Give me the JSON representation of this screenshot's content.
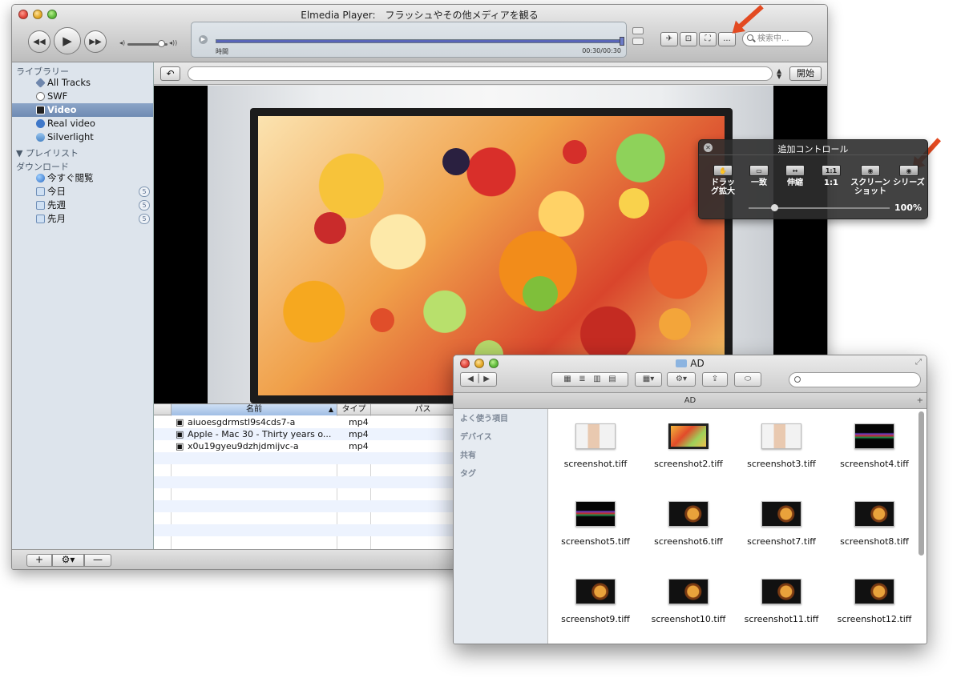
{
  "player": {
    "title": "Elmedia Player:　フラッシュやその他メディアを観る",
    "time_label": "時間",
    "time_value": "00:30/00:30",
    "progress": 1.0,
    "more_label": "...",
    "search_placeholder": "検索中...",
    "sidebar": {
      "library_header": "ライブラリー",
      "items": [
        {
          "label": "All Tracks",
          "icon": "music-note-icon"
        },
        {
          "label": "SWF",
          "icon": "flash-icon"
        },
        {
          "label": "Video",
          "icon": "film-icon",
          "selected": true
        },
        {
          "label": "Real video",
          "icon": "real-icon"
        },
        {
          "label": "Silverlight",
          "icon": "silverlight-icon"
        }
      ],
      "playlist_header": "▼ プレイリスト",
      "download_header": "ダウンロード",
      "download_items": [
        {
          "label": "今すぐ閲覧",
          "badge": ""
        },
        {
          "label": "今日",
          "badge": "5"
        },
        {
          "label": "先週",
          "badge": "5"
        },
        {
          "label": "先月",
          "badge": "5"
        }
      ]
    },
    "go_button": "開始",
    "table": {
      "columns": [
        "名前",
        "タイプ",
        "パス"
      ],
      "rows": [
        {
          "name": "aiuoesgdrmstl9s4cds7-a",
          "type": "mp4"
        },
        {
          "name": "Apple - Mac 30 - Thirty years o...",
          "type": "mp4"
        },
        {
          "name": "x0u19gyeu9dzhjdmijvc-a",
          "type": "mp4"
        }
      ]
    }
  },
  "hud": {
    "title": "追加コントロール",
    "buttons": [
      {
        "label": "ドラッグ拡大",
        "icon": "hand-icon"
      },
      {
        "label": "一致",
        "icon": "fit-icon"
      },
      {
        "label": "伸縮",
        "icon": "stretch-icon"
      },
      {
        "label": "1:1",
        "icon": "one-to-one-icon"
      },
      {
        "label": "スクリーンショット",
        "icon": "camera-icon"
      },
      {
        "label": "シリーズ",
        "icon": "camera-series-icon"
      }
    ],
    "zoom": "100%"
  },
  "finder": {
    "title": "AD",
    "tab": "AD",
    "sidebar": [
      "よく使う項目",
      "デバイス",
      "共有",
      "タグ"
    ],
    "files": [
      {
        "name": "screenshot.tiff",
        "thumb": "face"
      },
      {
        "name": "screenshot2.tiff",
        "thumb": "fruit"
      },
      {
        "name": "screenshot3.tiff",
        "thumb": "face"
      },
      {
        "name": "screenshot4.tiff",
        "thumb": "wave"
      },
      {
        "name": "screenshot5.tiff",
        "thumb": "wave"
      },
      {
        "name": "screenshot6.tiff",
        "thumb": "ad"
      },
      {
        "name": "screenshot7.tiff",
        "thumb": "ad"
      },
      {
        "name": "screenshot8.tiff",
        "thumb": "ad"
      },
      {
        "name": "screenshot9.tiff",
        "thumb": "ad"
      },
      {
        "name": "screenshot10.tiff",
        "thumb": "ad"
      },
      {
        "name": "screenshot11.tiff",
        "thumb": "ad"
      },
      {
        "name": "screenshot12.tiff",
        "thumb": "ad"
      }
    ]
  },
  "colors": {
    "selection": "#7a93ba",
    "sidebar_bg": "#dde4ec",
    "arrow": "#e34a21",
    "progress": "#5965b8"
  }
}
